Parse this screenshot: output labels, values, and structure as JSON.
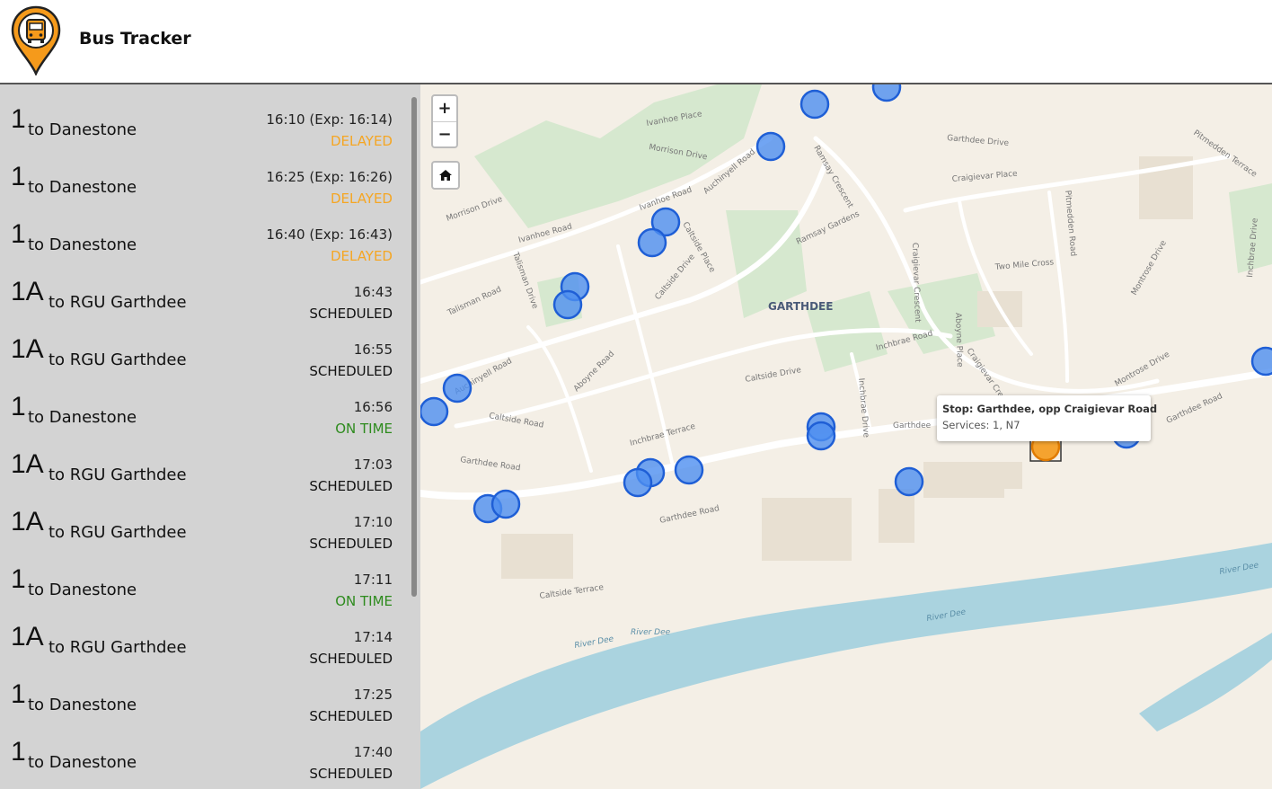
{
  "header": {
    "title": "Bus Tracker",
    "logo_icon": "bus-pin-logo-icon",
    "accent": "#f59a1b"
  },
  "departures": [
    {
      "route": "1",
      "destination": "to Danestone",
      "time": "16:10 (Exp: 16:14)",
      "status": "DELAYED",
      "status_color": "#f5a623"
    },
    {
      "route": "1",
      "destination": "to Danestone",
      "time": "16:25 (Exp: 16:26)",
      "status": "DELAYED",
      "status_color": "#f5a623"
    },
    {
      "route": "1",
      "destination": "to Danestone",
      "time": "16:40 (Exp: 16:43)",
      "status": "DELAYED",
      "status_color": "#f5a623"
    },
    {
      "route": "1A",
      "destination": "to RGU Garthdee",
      "time": "16:43",
      "status": "SCHEDULED",
      "status_color": "#111111"
    },
    {
      "route": "1A",
      "destination": "to RGU Garthdee",
      "time": "16:55",
      "status": "SCHEDULED",
      "status_color": "#111111"
    },
    {
      "route": "1",
      "destination": "to Danestone",
      "time": "16:56",
      "status": "ON TIME",
      "status_color": "#2e8b1e"
    },
    {
      "route": "1A",
      "destination": "to RGU Garthdee",
      "time": "17:03",
      "status": "SCHEDULED",
      "status_color": "#111111"
    },
    {
      "route": "1A",
      "destination": "to RGU Garthdee",
      "time": "17:10",
      "status": "SCHEDULED",
      "status_color": "#111111"
    },
    {
      "route": "1",
      "destination": "to Danestone",
      "time": "17:11",
      "status": "ON TIME",
      "status_color": "#2e8b1e"
    },
    {
      "route": "1A",
      "destination": "to RGU Garthdee",
      "time": "17:14",
      "status": "SCHEDULED",
      "status_color": "#111111"
    },
    {
      "route": "1",
      "destination": "to Danestone",
      "time": "17:25",
      "status": "SCHEDULED",
      "status_color": "#111111"
    },
    {
      "route": "1",
      "destination": "to Danestone",
      "time": "17:40",
      "status": "SCHEDULED",
      "status_color": "#111111"
    }
  ],
  "map": {
    "controls": {
      "zoom_in": "+",
      "zoom_out": "−",
      "home_icon": "home-icon"
    },
    "area_label": "GARTHDEE",
    "street_labels": [
      "Ivanhoe Place",
      "Morrison Drive",
      "Ivanhoe Road",
      "Auchinyell Road",
      "Ramsay Crescent",
      "Garthdee Drive",
      "Craigievar Place",
      "Pitmedden Terrace",
      "Pitmedden Road",
      "Morrison Drive",
      "Ivanhoe Road",
      "Caltside Place",
      "Ramsay Gardens",
      "Talisman Drive",
      "Talisman Road",
      "Auchinyell Road",
      "Caltside Drive",
      "Aboyne Road",
      "Craigievar Crescent",
      "Aboyne Place",
      "Two Mile Cross",
      "Montrose Drive",
      "Inchbrae Drive",
      "Inchbrae Road",
      "Caltside Drive",
      "Inchbrae Drive",
      "Craigievar Crescent",
      "Montrose Drive",
      "Garthdee Road",
      "Caltside Terrace",
      "Caltside Road",
      "Inchbrae Terrace",
      "Garthdee Road",
      "Garthdee Road",
      "Garthdee",
      "River Dee",
      "River Dee",
      "River Dee",
      "River Dee"
    ],
    "stop_marker_color": "#4d8ef0",
    "selected_stop_color": "#f59a1b",
    "tooltip": {
      "title": "Stop: Garthdee, opp Craigievar Road",
      "services": "Services: 1, N7"
    }
  }
}
